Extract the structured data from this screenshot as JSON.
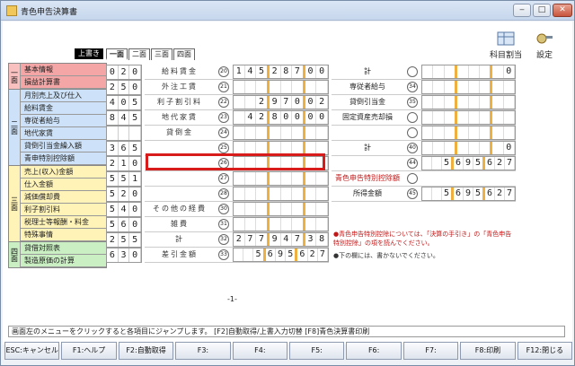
{
  "window": {
    "title": "青色申告決算書"
  },
  "toolbar": {
    "subject_split": "科目割当",
    "settings": "設定"
  },
  "overwrite_label": "上書き",
  "tabs": [
    "一面",
    "二面",
    "三面",
    "四面"
  ],
  "sidebar": [
    {
      "section": "一面",
      "items": [
        "基本情報",
        "損益計算書"
      ]
    },
    {
      "section": "二面",
      "items": [
        "月別売上及び仕入",
        "給料賃金",
        "専従者給与",
        "地代家賃",
        "貸倒引当金繰入額",
        "青申特別控除額"
      ]
    },
    {
      "section": "三面",
      "items": [
        "売上(収入)金額",
        "仕入金額",
        "減価償却費",
        "利子割引料",
        "税理士等報酬・料金",
        "特殊事情"
      ]
    },
    {
      "section": "四面",
      "items": [
        "貸借対照表",
        "製造原価の計算"
      ]
    }
  ],
  "codes": [
    "020",
    "250",
    "405",
    "845",
    "",
    "365",
    "210",
    "551",
    "520",
    "540",
    "560",
    "255",
    "630"
  ],
  "form_rows": [
    {
      "label": "給料賃金",
      "num": "20",
      "digits": [
        "1",
        "4",
        "5",
        "2",
        "8",
        "7",
        "0",
        "0"
      ]
    },
    {
      "label": "外注工賃",
      "num": "21",
      "digits": [
        "",
        "",
        "",
        "",
        "",
        "",
        "",
        ""
      ]
    },
    {
      "label": "利子割引料",
      "num": "22",
      "digits": [
        "",
        "",
        "2",
        "9",
        "7",
        "0",
        "0",
        "2"
      ]
    },
    {
      "label": "地代家賃",
      "num": "23",
      "digits": [
        "",
        "4",
        "2",
        "8",
        "0",
        "0",
        "0",
        "0"
      ]
    },
    {
      "label": "貸倒金",
      "num": "24",
      "digits": [
        "",
        "",
        "",
        "",
        "",
        "",
        "",
        ""
      ]
    },
    {
      "label": "",
      "num": "25",
      "digits": [
        "",
        "",
        "",
        "",
        "",
        "",
        "",
        ""
      ]
    },
    {
      "label": "",
      "num": "26",
      "digits": [
        "",
        "",
        "",
        "",
        "",
        "",
        "",
        ""
      ]
    },
    {
      "label": "",
      "num": "27",
      "digits": [
        "",
        "",
        "",
        "",
        "",
        "",
        "",
        ""
      ]
    },
    {
      "label": "",
      "num": "28",
      "digits": [
        "",
        "",
        "",
        "",
        "",
        "",
        "",
        ""
      ]
    },
    {
      "label": "その他の経費",
      "num": "30",
      "digits": [
        "",
        "",
        "",
        "",
        "",
        "",
        "",
        ""
      ]
    },
    {
      "label": "雑費",
      "num": "31",
      "digits": [
        "",
        "",
        "",
        "",
        "",
        "",
        "",
        ""
      ]
    },
    {
      "label": "計",
      "num": "32",
      "digits": [
        "2",
        "7",
        "7",
        "9",
        "4",
        "7",
        "3",
        "8"
      ]
    },
    {
      "label": "差引金額",
      "num": "33",
      "digits": [
        "",
        "",
        "5",
        "6",
        "9",
        "5",
        "6",
        "2",
        "7"
      ]
    }
  ],
  "right_rows": [
    {
      "label": "計",
      "num": "",
      "digits": [
        "",
        "",
        "",
        "",
        "",
        "",
        "",
        "0"
      ]
    },
    {
      "label": "専従者給与",
      "num": "34",
      "digits": [
        "",
        "",
        "",
        "",
        "",
        "",
        "",
        ""
      ]
    },
    {
      "label": "貸倒引当金",
      "num": "35",
      "digits": [
        "",
        "",
        "",
        "",
        "",
        "",
        "",
        ""
      ]
    },
    {
      "label": "固定資産売却損",
      "num": "",
      "digits": [
        "",
        "",
        "",
        "",
        "",
        "",
        "",
        ""
      ]
    },
    {
      "label": "",
      "num": "",
      "digits": [
        "",
        "",
        "",
        "",
        "",
        "",
        "",
        ""
      ]
    },
    {
      "label": "計",
      "num": "40",
      "digits": [
        "",
        "",
        "",
        "",
        "",
        "",
        "",
        "0"
      ]
    },
    {
      "label": "",
      "num": "44",
      "digits": [
        "",
        "",
        "5",
        "6",
        "9",
        "5",
        "6",
        "2",
        "7"
      ]
    },
    {
      "label": "青色申告特別控除額",
      "num": "",
      "digits": []
    },
    {
      "label": "所得金額",
      "num": "45",
      "digits": [
        "",
        "",
        "5",
        "6",
        "9",
        "5",
        "6",
        "2",
        "7"
      ]
    }
  ],
  "notes": [
    "●青色申告特別控除については、「決算の手引き」の「青色申告特別控除」の項を読んでください。",
    "●下の欄には、書かないでください。"
  ],
  "page_no": "-1-",
  "status": "画面左のメニューをクリックすると各項目にジャンプします。 [F2]自動取得/上書入力切替  [F8]青色決算書印刷",
  "fkeys": [
    "ESC:キャンセル",
    "F1:ヘルプ",
    "F2:自動取得",
    "F3:",
    "F4:",
    "F5:",
    "F6:",
    "F7:",
    "F8:印刷",
    "F12:閉じる"
  ]
}
